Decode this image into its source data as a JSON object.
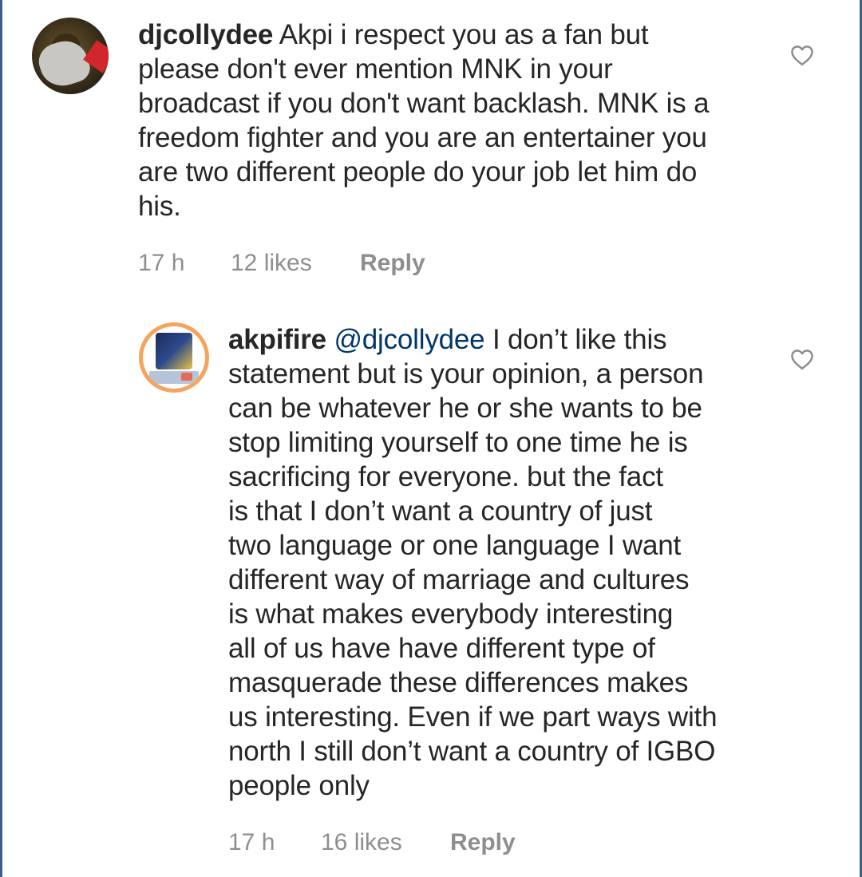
{
  "comments": [
    {
      "username": "djcollydee",
      "mention": "",
      "text_lines": [
        "Akpi i respect you as a fan but",
        "please don't ever mention MNK in your",
        "broadcast if you don't want backlash. MNK is a",
        "freedom fighter and you are an entertainer you",
        "are two different people do your job let him do",
        "his."
      ],
      "time": "17 h",
      "likes": "12 likes",
      "reply_label": "Reply",
      "like_icon": "heart-outline-icon"
    },
    {
      "username": "akpifire",
      "mention": "@djcollydee",
      "text_lines": [
        "I don’t like this",
        "statement but is your opinion, a person",
        "can be whatever he or she wants to be",
        "stop limiting yourself to one time he is",
        "sacrificing for everyone. but the fact",
        "is that I don’t want a country of just",
        "two language or one language I want",
        "different way of marriage and cultures",
        "is what makes everybody interesting",
        "all of us have have different type of",
        "masquerade these differences makes",
        "us interesting. Even if we part ways with",
        "north I still don’t want a country of IGBO",
        "people only"
      ],
      "time": "17 h",
      "likes": "16 likes",
      "reply_label": "Reply",
      "like_icon": "heart-outline-icon"
    }
  ],
  "colors": {
    "text": "#262626",
    "secondary": "#8e8e8e",
    "mention": "#00376b",
    "story_ring": "#f5a45d"
  }
}
